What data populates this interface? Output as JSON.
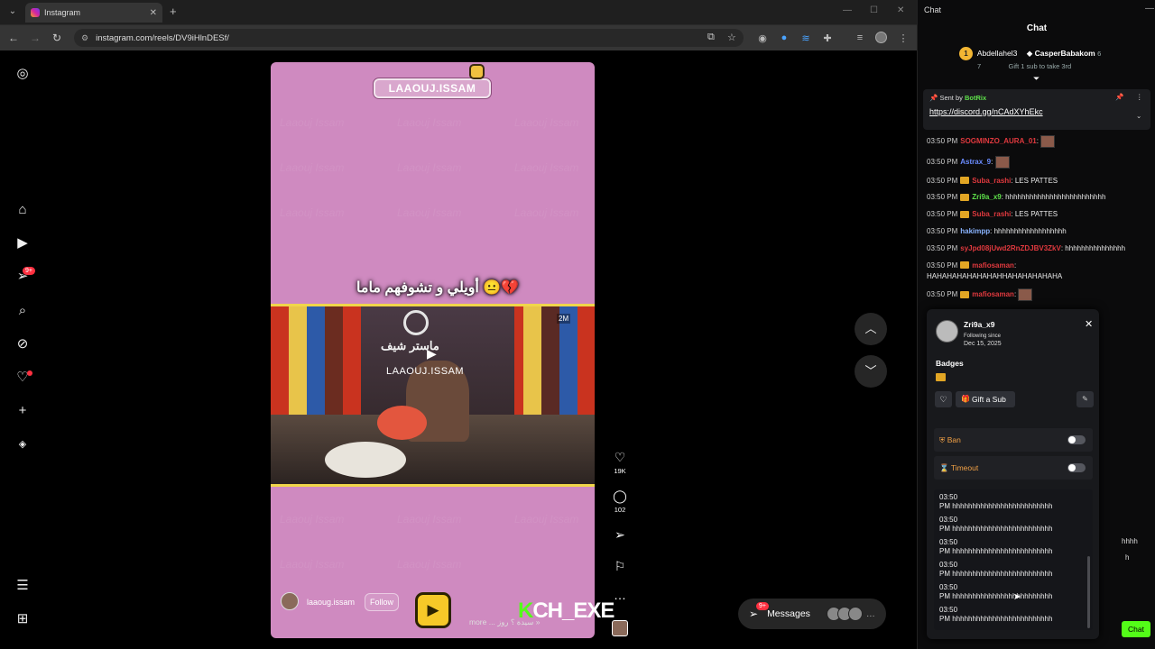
{
  "browser": {
    "tab_title": "Instagram",
    "url": "instagram.com/reels/DV9iHlnDESf/"
  },
  "sidebar": {
    "notification_badge": "9+"
  },
  "reel": {
    "tag_text": "LAAOUJ.ISSAM",
    "caption": "أويلي و تشوفهم ماما 😐💔",
    "video_logo_text": "ماستر شيف",
    "video_watermark": "LAAOUJ.ISSAM",
    "video_corner": "2M",
    "author": "laaoug.issam",
    "follow_label": "Follow",
    "description": "more ... سيدة ؟ روز »",
    "likes": "19K",
    "comments": "102",
    "bg_watermark": "Laaouj Issam"
  },
  "overlay": {
    "kick_logo": "CH_EXE",
    "kick_k": "K"
  },
  "messages_pill": {
    "label": "Messages",
    "badge": "9+"
  },
  "chat": {
    "window_title": "Chat",
    "header": "Chat",
    "top_gifter_1": "Abdellahel3",
    "top_gifter_1_count": "7",
    "top_gifter_2": "CasperBabakom",
    "top_gifter_2_count": "6",
    "top_gifter_note": "Gift 1 sub to take 3rd",
    "rank": "1",
    "pinned_sent_by": "Sent by",
    "pinned_user": "BotRix",
    "pinned_link": "https://discord.gg/nCAdXYhEkc",
    "messages": [
      {
        "time": "03:50 PM",
        "user": "SOGMINZO_AURA_01",
        "text": "",
        "color": "#e0393e"
      },
      {
        "time": "03:50 PM",
        "user": "Astrax_9",
        "text": "",
        "color": "#6b8cff"
      },
      {
        "time": "03:50 PM",
        "user": "Suba_rashi",
        "text": "LES PATTES",
        "color": "#e0393e"
      },
      {
        "time": "03:50 PM",
        "user": "Zri9a_x9",
        "text": "hhhhhhhhhhhhhhhhhhhhhhhhh",
        "color": "#5ee04a"
      },
      {
        "time": "03:50 PM",
        "user": "Suba_rashi",
        "text": "LES PATTES",
        "color": "#e0393e"
      },
      {
        "time": "03:50 PM",
        "user": "hakimpp",
        "text": "hhhhhhhhhhhhhhhhhh",
        "color": "#8ab4ff"
      },
      {
        "time": "03:50 PM",
        "user": "syJpd08jUwd2RnZDJBV3ZkV",
        "text": "hhhhhhhhhhhhhhh",
        "color": "#e0393e"
      },
      {
        "time": "03:50 PM",
        "user": "mafiosaman",
        "text": "",
        "color": "#e0393e"
      },
      {
        "time": "",
        "user": "",
        "text": "HAHAHAHAHAHAHAHHAHAHAHAHAHA",
        "color": "#eaeaea"
      },
      {
        "time": "03:50 PM",
        "user": "mafiosaman",
        "text": "",
        "color": "#e0393e"
      },
      {
        "time": "03:50 PM",
        "user": "mafiosaman",
        "text": "",
        "color": "#e0393e"
      }
    ],
    "behind_text_1": "hhhh",
    "behind_text_2": "h",
    "chat_button": "Chat"
  },
  "user_card": {
    "name": "Zri9a_x9",
    "following_since_label": "Following since",
    "following_date": "Dec 15, 2025",
    "badges_label": "Badges",
    "gift_label": "Gift a Sub",
    "ban_label": "Ban",
    "timeout_label": "Timeout",
    "log": [
      {
        "time": "03:50",
        "text": "PM hhhhhhhhhhhhhhhhhhhhhhhhh"
      },
      {
        "time": "03:50",
        "text": "PM hhhhhhhhhhhhhhhhhhhhhhhhh"
      },
      {
        "time": "03:50",
        "text": "PM hhhhhhhhhhhhhhhhhhhhhhhhh"
      },
      {
        "time": "03:50",
        "text": "PM hhhhhhhhhhhhhhhhhhhhhhhhh"
      },
      {
        "time": "03:50",
        "text": "PM hhhhhhhhhhhhhhhhhhhhhhhhh"
      },
      {
        "time": "03:50",
        "text": "PM hhhhhhhhhhhhhhhhhhhhhhhhh"
      }
    ]
  },
  "colors": {
    "kick_green": "#53fc18",
    "ig_red": "#ff3040",
    "mod_orange": "#f0a045"
  }
}
